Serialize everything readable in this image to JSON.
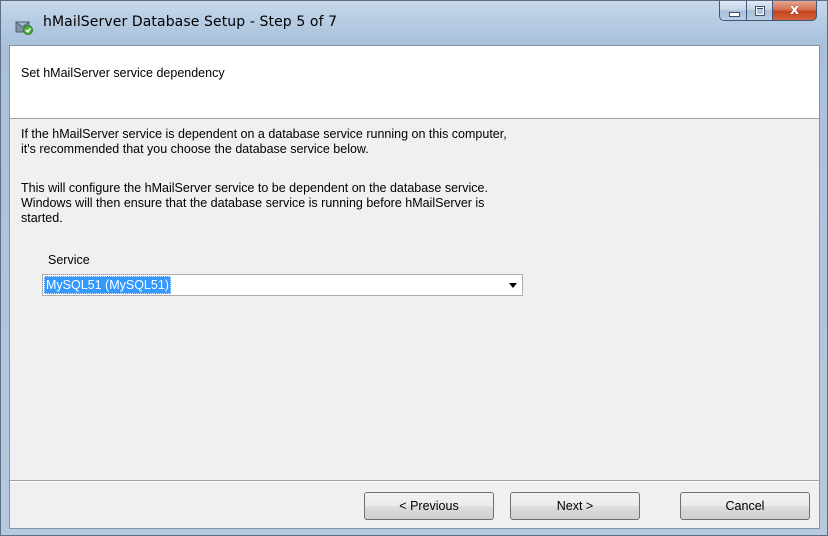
{
  "window": {
    "title": "hMailServer Database Setup - Step 5 of 7",
    "close_glyph": "x"
  },
  "header": {
    "title": "Set hMailServer service dependency"
  },
  "body": {
    "paragraph1_line1": "If the hMailServer service is dependent on a database service running on this computer,",
    "paragraph1_line2": "it's recommended that you choose the database service below.",
    "paragraph2_line1": "This will configure the hMailServer service to be dependent on the database service.",
    "paragraph2_line2": "Windows will then ensure that the database service is running before hMailServer is",
    "paragraph2_line3": "started."
  },
  "service": {
    "label": "Service",
    "selected": "MySQL51 (MySQL51)"
  },
  "buttons": {
    "previous": "< Previous",
    "next": "Next >",
    "cancel": "Cancel"
  },
  "icons": {
    "app": "hmailserver-setup-icon",
    "minimize": "minimize-icon",
    "maximize": "maximize-icon",
    "close": "close-icon",
    "dropdown": "chevron-down-icon"
  },
  "colors": {
    "selection": "#3399ff",
    "close_button": "#c3451c"
  }
}
